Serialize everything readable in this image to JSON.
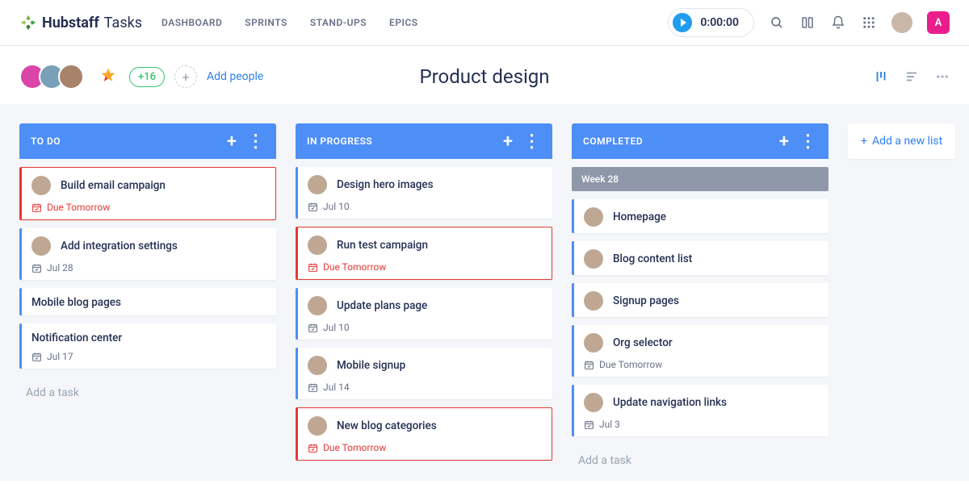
{
  "brand": {
    "name": "Hubstaff",
    "sub": "Tasks"
  },
  "nav": [
    "DASHBOARD",
    "SPRINTS",
    "STAND-UPS",
    "EPICS"
  ],
  "timer": "0:00:00",
  "user_badge": "A",
  "people_count": "+16",
  "add_people": "Add people",
  "board_title": "Product design",
  "add_list": "Add a new list",
  "add_task": "Add a task",
  "columns": [
    {
      "title": "TO DO",
      "cards": [
        {
          "title": "Build email campaign",
          "meta": "Due Tomorrow",
          "overdue": true,
          "avatar": true
        },
        {
          "title": "Add integration settings",
          "meta": "Jul 28",
          "overdue": false,
          "avatar": true
        },
        {
          "title": "Mobile blog pages",
          "meta": "",
          "overdue": false,
          "avatar": false
        },
        {
          "title": "Notification center",
          "meta": "Jul 17",
          "overdue": false,
          "avatar": false
        }
      ],
      "show_add": true
    },
    {
      "title": "IN PROGRESS",
      "cards": [
        {
          "title": "Design hero images",
          "meta": "Jul 10",
          "overdue": false,
          "avatar": true
        },
        {
          "title": "Run test campaign",
          "meta": "Due Tomorrow",
          "overdue": true,
          "avatar": true
        },
        {
          "title": "Update plans page",
          "meta": "Jul 10",
          "overdue": false,
          "avatar": true
        },
        {
          "title": "Mobile signup",
          "meta": "Jul 14",
          "overdue": false,
          "avatar": true
        },
        {
          "title": "New blog categories",
          "meta": "Due Tomorrow",
          "overdue": true,
          "avatar": true
        }
      ],
      "show_add": false
    },
    {
      "title": "COMPLETED",
      "week": "Week 28",
      "cards": [
        {
          "title": "Homepage",
          "meta": "",
          "overdue": false,
          "avatar": true
        },
        {
          "title": "Blog content list",
          "meta": "",
          "overdue": false,
          "avatar": true
        },
        {
          "title": "Signup pages",
          "meta": "",
          "overdue": false,
          "avatar": true
        },
        {
          "title": "Org selector",
          "meta": "Due Tomorrow",
          "overdue": false,
          "avatar": true
        },
        {
          "title": "Update navigation links",
          "meta": "Jul 3",
          "overdue": false,
          "avatar": true
        }
      ],
      "show_add": true
    }
  ]
}
